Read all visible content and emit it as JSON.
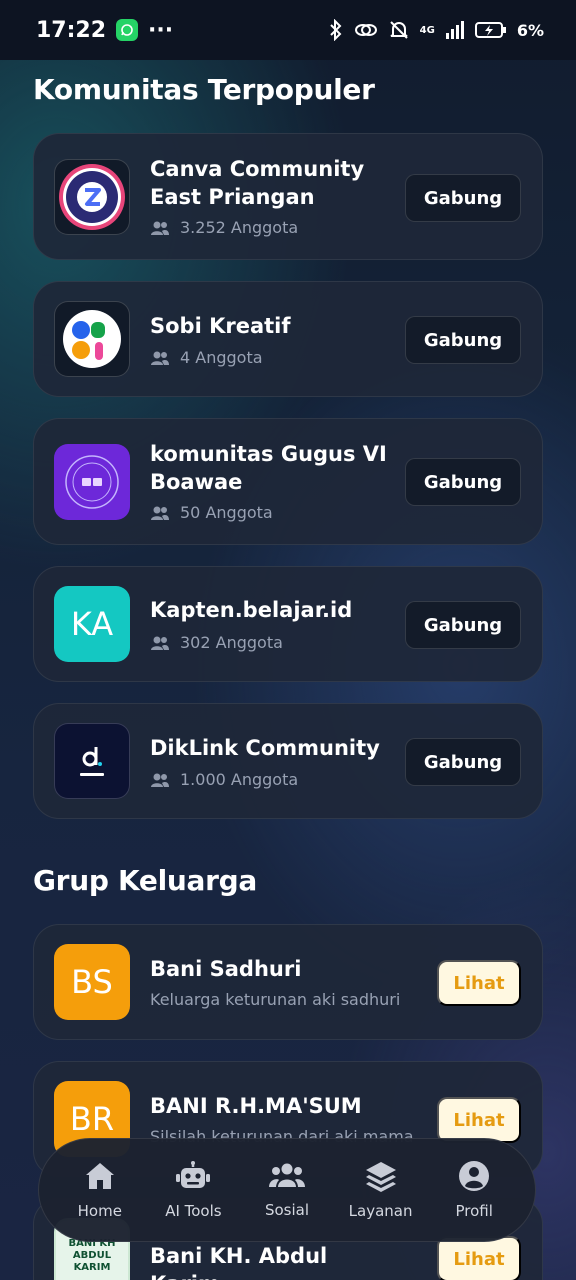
{
  "status_bar": {
    "time": "17:22",
    "more": "···",
    "network": "4G",
    "battery": "6%"
  },
  "popular": {
    "title": "Komunitas Terpopuler",
    "join_label": "Gabung",
    "items": [
      {
        "name": "Canva Community East Priangan",
        "members": "3.252 Anggota",
        "logo": "canva-community-logo"
      },
      {
        "name": "Sobi Kreatif",
        "members": "4 Anggota",
        "logo": "sobi-logo"
      },
      {
        "name": "komunitas Gugus VI Boawae",
        "members": "50 Anggota",
        "logo": "gugus-logo"
      },
      {
        "name": "Kapten.belajar.id",
        "members": "302 Anggota",
        "initials": "KA",
        "color": "#14c8c2"
      },
      {
        "name": "DikLink Community",
        "members": "1.000 Anggota",
        "logo": "diklink-logo"
      }
    ]
  },
  "family": {
    "title": "Grup Keluarga",
    "view_label": "Lihat",
    "items": [
      {
        "name": "Bani Sadhuri",
        "desc": "Keluarga keturunan aki sadhuri",
        "initials": "BS",
        "color": "#f59e0b"
      },
      {
        "name": "BANI R.H.MA'SUM",
        "desc": "Silsilah keturunan dari aki mama",
        "initials": "BR",
        "color": "#f59e0b"
      },
      {
        "name": "Bani KH. Abdul Karim",
        "logo": "bani-kh-logo",
        "logo_text": "BANI KH ABDUL KARIM"
      }
    ]
  },
  "nav": {
    "items": [
      {
        "label": "Home",
        "icon": "home-icon"
      },
      {
        "label": "AI Tools",
        "icon": "robot-icon"
      },
      {
        "label": "Sosial",
        "icon": "users-icon"
      },
      {
        "label": "Layanan",
        "icon": "layers-icon"
      },
      {
        "label": "Profil",
        "icon": "user-circle-icon"
      }
    ]
  },
  "colors": {
    "accent_yellow": "#f59e0b",
    "teal": "#14c8c2",
    "purple": "#6d28d9",
    "view_bg": "#fff8e1"
  }
}
